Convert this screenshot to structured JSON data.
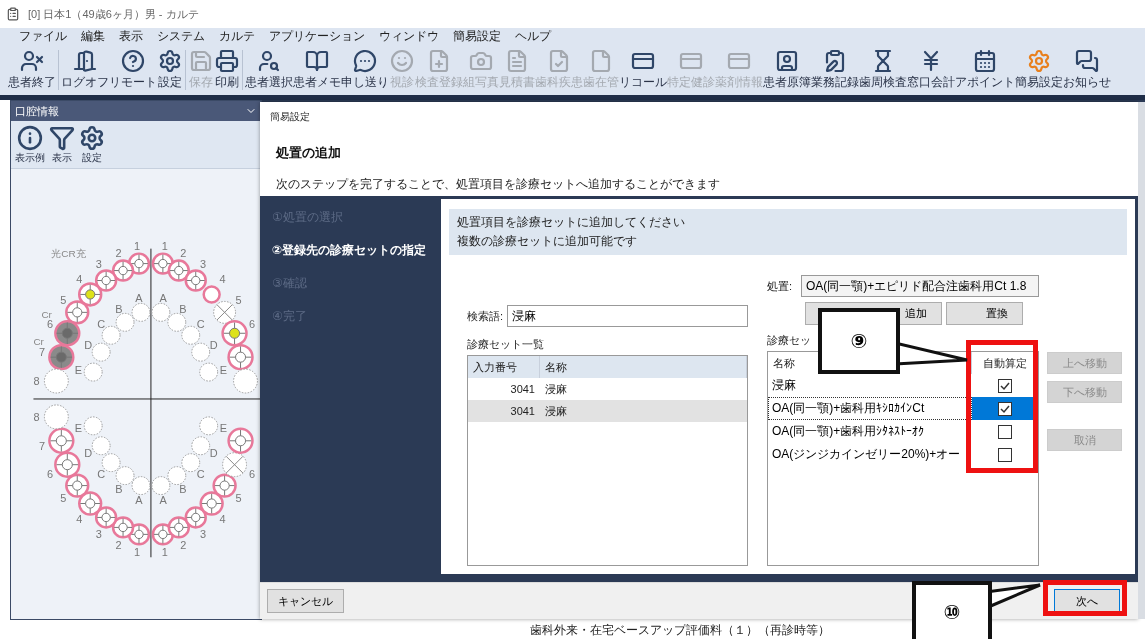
{
  "window": {
    "title": "[0] 日本1（49歳6ヶ月）男 - カルテ"
  },
  "menu": [
    "ファイル",
    "編集",
    "表示",
    "システム",
    "カルテ",
    "アプリケーション",
    "ウィンドウ",
    "簡易設定",
    "ヘルプ"
  ],
  "toolbar": [
    {
      "label": "患者終了",
      "disabled": false
    },
    {
      "label": "ログオフ",
      "disabled": false
    },
    {
      "label": "リモート",
      "disabled": false
    },
    {
      "label": "設定",
      "disabled": false
    },
    {
      "label": "保存",
      "disabled": true
    },
    {
      "label": "印刷",
      "disabled": false
    },
    {
      "label": "患者選択",
      "disabled": false
    },
    {
      "label": "患者メモ",
      "disabled": false
    },
    {
      "label": "申し送り",
      "disabled": false
    },
    {
      "label": "視診",
      "disabled": true
    },
    {
      "label": "検査登録",
      "disabled": true
    },
    {
      "label": "組写真",
      "disabled": true
    },
    {
      "label": "見積書",
      "disabled": true
    },
    {
      "label": "歯科疾患",
      "disabled": true
    },
    {
      "label": "歯在管",
      "disabled": true
    },
    {
      "label": "リコール",
      "disabled": false
    },
    {
      "label": "特定健診",
      "disabled": true
    },
    {
      "label": "薬剤情報",
      "disabled": true
    },
    {
      "label": "患者原簿",
      "disabled": false
    },
    {
      "label": "業務記録",
      "disabled": false
    },
    {
      "label": "歯周検査",
      "disabled": false
    },
    {
      "label": "窓口会計",
      "disabled": false
    },
    {
      "label": "アポイント",
      "disabled": false
    },
    {
      "label": "簡易設定",
      "disabled": false
    },
    {
      "label": "お知らせ",
      "disabled": false
    }
  ],
  "oral_panel": {
    "title": "口腔情報",
    "tools": [
      {
        "label": "表示例"
      },
      {
        "label": "表示"
      },
      {
        "label": "設定"
      }
    ],
    "chart": {
      "quadrants": [
        {
          "teeth": [
            {
              "label": "1",
              "kind": "ring"
            },
            {
              "label": "2",
              "kind": "ring"
            },
            {
              "label": "3",
              "kind": "ring"
            },
            {
              "label": "4",
              "kind": "ring_yellow"
            },
            {
              "label": "5",
              "kind": "ring"
            },
            {
              "label": "6",
              "kind": "crown"
            },
            {
              "label": "7",
              "kind": "crown"
            },
            {
              "label": "8",
              "kind": "plain"
            }
          ],
          "primary": [
            "A",
            "B",
            "C",
            "D",
            "E"
          ]
        },
        {
          "teeth": [
            {
              "label": "1",
              "kind": "ring"
            },
            {
              "label": "2",
              "kind": "ring"
            },
            {
              "label": "3",
              "kind": "ring"
            },
            {
              "label": "4",
              "kind": "ring_empty"
            },
            {
              "label": "5",
              "kind": "cross"
            },
            {
              "label": "6",
              "kind": "ring_yellow"
            },
            {
              "kind": "ring"
            },
            {
              "kind": "plain"
            }
          ],
          "primary": [
            "A",
            "B",
            "C",
            "D",
            "E"
          ]
        },
        {
          "teeth": [
            {
              "label": "1",
              "kind": "ring"
            },
            {
              "label": "2",
              "kind": "ring"
            },
            {
              "label": "3",
              "kind": "ring"
            },
            {
              "label": "4",
              "kind": "ring"
            },
            {
              "label": "5",
              "kind": "ring"
            },
            {
              "label": "6",
              "kind": "ring"
            },
            {
              "label": "7",
              "kind": "ring"
            },
            {
              "label": "8",
              "kind": "plain"
            }
          ],
          "primary": [
            "A",
            "B",
            "C",
            "D",
            "E"
          ]
        },
        {
          "teeth": [
            {
              "label": "1",
              "kind": "ring"
            },
            {
              "label": "2",
              "kind": "ring"
            },
            {
              "label": "3",
              "kind": "ring"
            },
            {
              "label": "4",
              "kind": "ring"
            },
            {
              "label": "5",
              "kind": "ring"
            },
            {
              "label": "6",
              "kind": "cross"
            },
            {
              "kind": "ring"
            }
          ],
          "primary": [
            "A",
            "B",
            "C",
            "D",
            "E"
          ]
        }
      ],
      "annotations": [
        "光CR充",
        "Cr",
        "Cr"
      ]
    }
  },
  "dialog": {
    "title": "簡易設定",
    "heading": "処置の追加",
    "description": "次のステップを完了することで、処置項目を診療セットへ追加することができます",
    "steps": [
      {
        "label": "①処置の選択",
        "selected": false
      },
      {
        "label": "②登録先の診療セットの指定",
        "selected": true
      },
      {
        "label": "③確認",
        "selected": false
      },
      {
        "label": "④完了",
        "selected": false
      }
    ],
    "instructions": [
      "処置項目を診療セットに追加してください",
      "複数の診療セットに追加可能です"
    ],
    "treatment": {
      "label": "処置:",
      "value": "OA(同一顎)+エピリド配合注歯科用Ct 1.8"
    },
    "action_buttons": [
      "追加",
      "置換"
    ],
    "search": {
      "label": "検索語:",
      "value": "浸麻"
    },
    "set_list": {
      "title": "診療セット一覧",
      "columns": [
        "入力番号",
        "名称"
      ],
      "rows": [
        {
          "code": "3041",
          "name": "浸麻",
          "selected": false
        },
        {
          "code": "3041",
          "name": "浸麻",
          "selected": true
        }
      ]
    },
    "target_list": {
      "title": "診療セッ",
      "columns": [
        "名称",
        "自動算定"
      ],
      "rows": [
        {
          "name": "浸麻",
          "checked": true,
          "selected": false
        },
        {
          "name": "OA(同一顎)+歯科用ｷｼﾛｶｲﾝCt",
          "checked": true,
          "selected": true
        },
        {
          "name": "OA(同一顎)+歯科用ｼﾀﾈｽﾄｰｵｸ",
          "checked": false,
          "selected": false
        },
        {
          "name": "OA(ジンジカインゼリー20%)+オー",
          "checked": false,
          "selected": false
        }
      ]
    },
    "side_buttons": [
      {
        "label": "上へ移動",
        "disabled": true
      },
      {
        "label": "下へ移動",
        "disabled": true
      },
      {
        "label": "取消",
        "disabled": true
      }
    ],
    "cancel_button": "キャンセル",
    "next_button": "次へ"
  },
  "callouts": [
    "⑨",
    "⑩"
  ],
  "background_text": "歯科外来・在宅ベースアップ評価料（１）（再診時等）"
}
